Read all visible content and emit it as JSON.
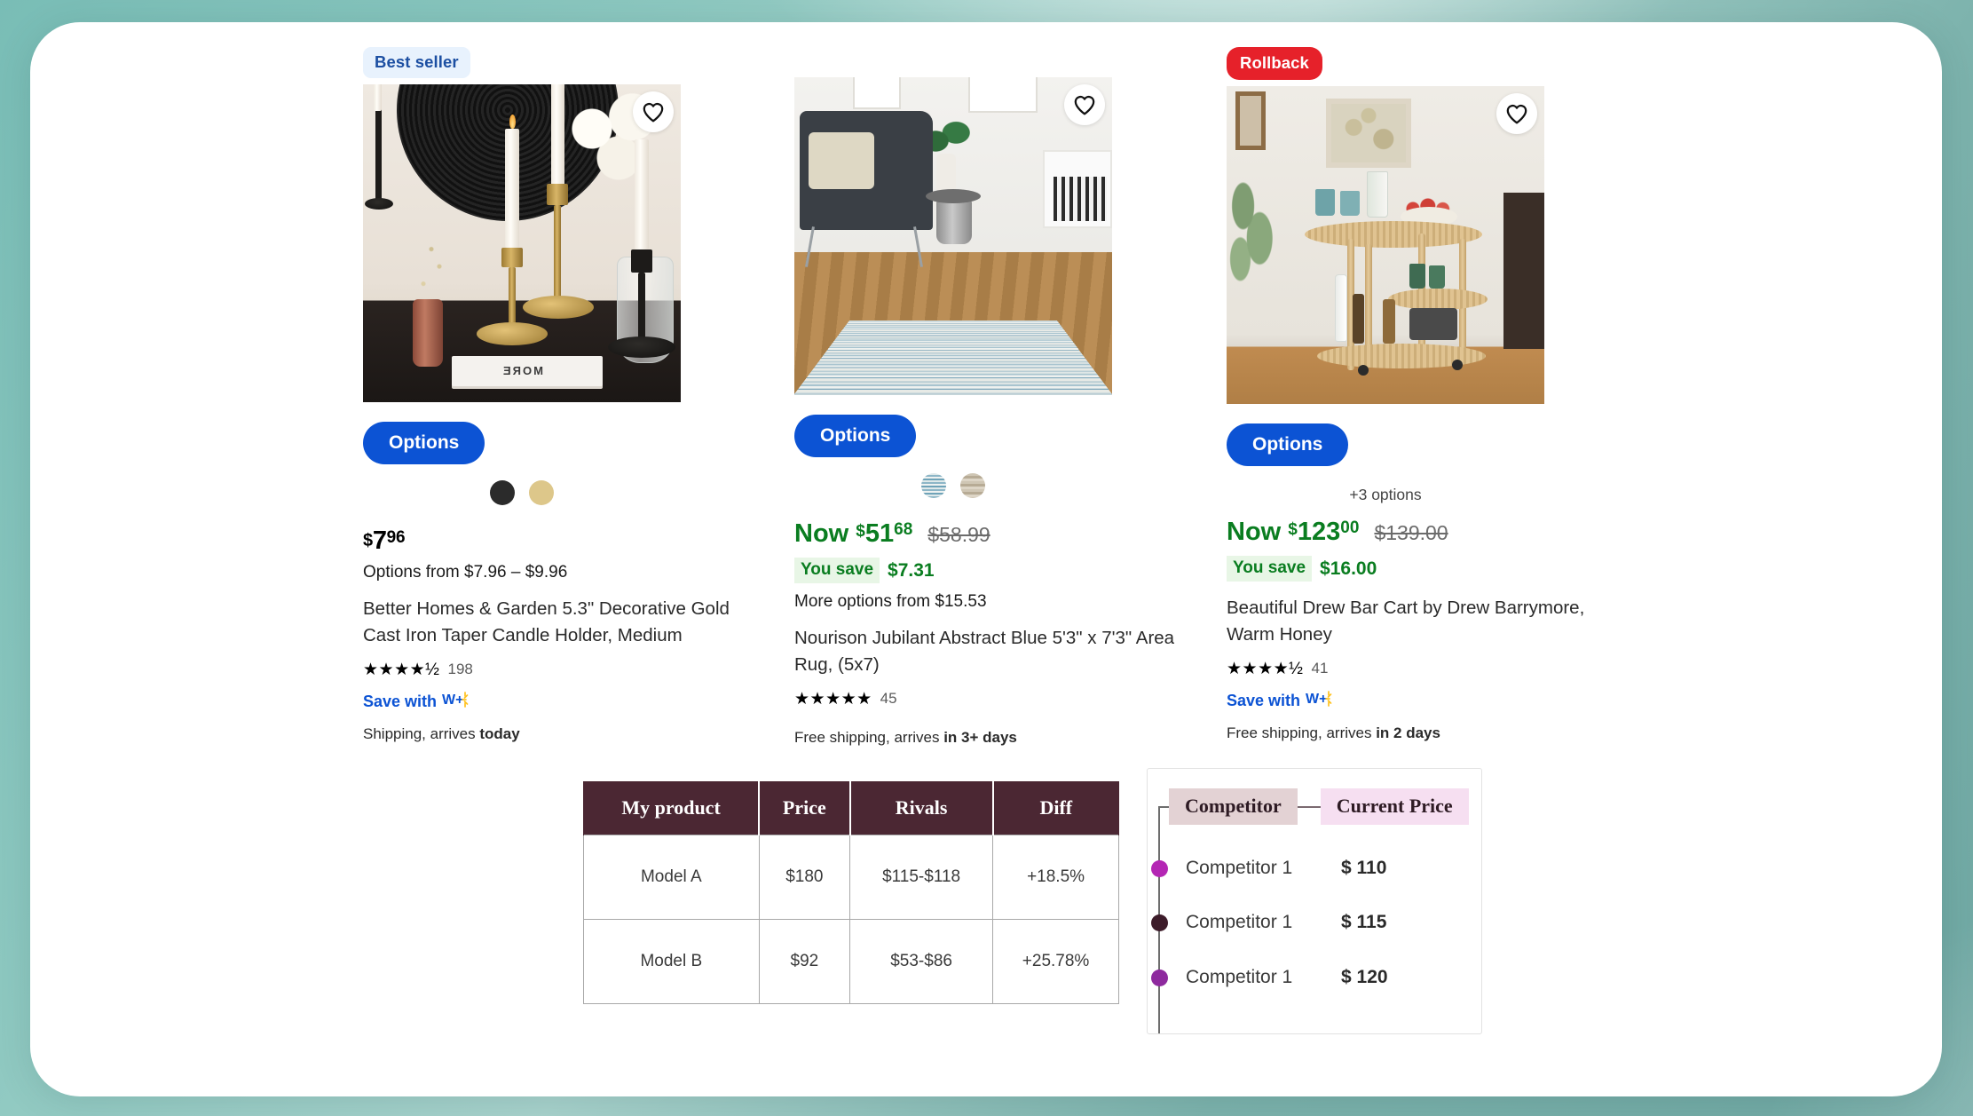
{
  "products": [
    {
      "badge": "Best seller",
      "badge_type": "bestseller",
      "options_label": "Options",
      "price_currency": "$",
      "price_dollars": "7",
      "price_cents": "96",
      "options_from": "Options from $7.96 – $9.96",
      "title": "Better Homes & Garden 5.3\" Decorative Gold Cast Iron Taper Candle Holder, Medium",
      "stars": "★★★★½",
      "rating_count": "198",
      "wplus_label": "Save with",
      "wplus_mark": "W+",
      "shipping": "Shipping, arrives ",
      "shipping_em": "today",
      "swatches": [
        "#2b2b2b",
        "#ddc78a"
      ]
    },
    {
      "badge": "",
      "badge_type": "none",
      "options_label": "Options",
      "now_label": "Now",
      "price_currency": "$",
      "price_dollars": "51",
      "price_cents": "68",
      "was_price": "$58.99",
      "save_label": "You save",
      "save_amount": "$7.31",
      "more_options": "More options from $15.53",
      "title": "Nourison Jubilant Abstract Blue 5'3\" x 7'3\" Area Rug, (5x7)",
      "stars": "★★★★★",
      "rating_count": "45",
      "shipping": "Free shipping, arrives ",
      "shipping_em": "in 3+ days",
      "swatches": [
        "#8fb6c6",
        "#b8ab93"
      ]
    },
    {
      "badge": "Rollback",
      "badge_type": "rollback",
      "options_label": "Options",
      "plus_options": "+3 options",
      "now_label": "Now",
      "price_currency": "$",
      "price_dollars": "123",
      "price_cents": "00",
      "was_price": "$139.00",
      "save_label": "You save",
      "save_amount": "$16.00",
      "title": "Beautiful Drew Bar Cart by Drew Barrymore, Warm Honey",
      "stars": "★★★★½",
      "rating_count": "41",
      "wplus_label": "Save with",
      "wplus_mark": "W+",
      "shipping": "Free shipping, arrives ",
      "shipping_em": "in 2 days"
    }
  ],
  "compare_table": {
    "headers": [
      "My product",
      "Price",
      "Rivals",
      "Diff"
    ],
    "rows": [
      [
        "Model A",
        "$180",
        "$115-$118",
        "+18.5%"
      ],
      [
        "Model B",
        "$92",
        "$53-$86",
        "+25.78%"
      ]
    ]
  },
  "competitor_panel": {
    "header_competitor": "Competitor",
    "header_price": "Current Price",
    "rows": [
      {
        "name": "Competitor 1",
        "price": "$ 110",
        "dot_color": "#b426b4"
      },
      {
        "name": "Competitor 1",
        "price": "$ 115",
        "dot_color": "#3d1c2a"
      },
      {
        "name": "Competitor 1",
        "price": "$ 120",
        "dot_color": "#8e2a9e"
      }
    ]
  },
  "colors": {
    "background": "#8cc7c0",
    "card": "#ffffff",
    "accent_blue": "#0c53d4",
    "price_green": "#0a7d20",
    "rollback_red": "#e6212a",
    "table_header": "#4b2733",
    "chip_competitor": "#e3d2d4",
    "chip_price": "#f6dff1"
  }
}
